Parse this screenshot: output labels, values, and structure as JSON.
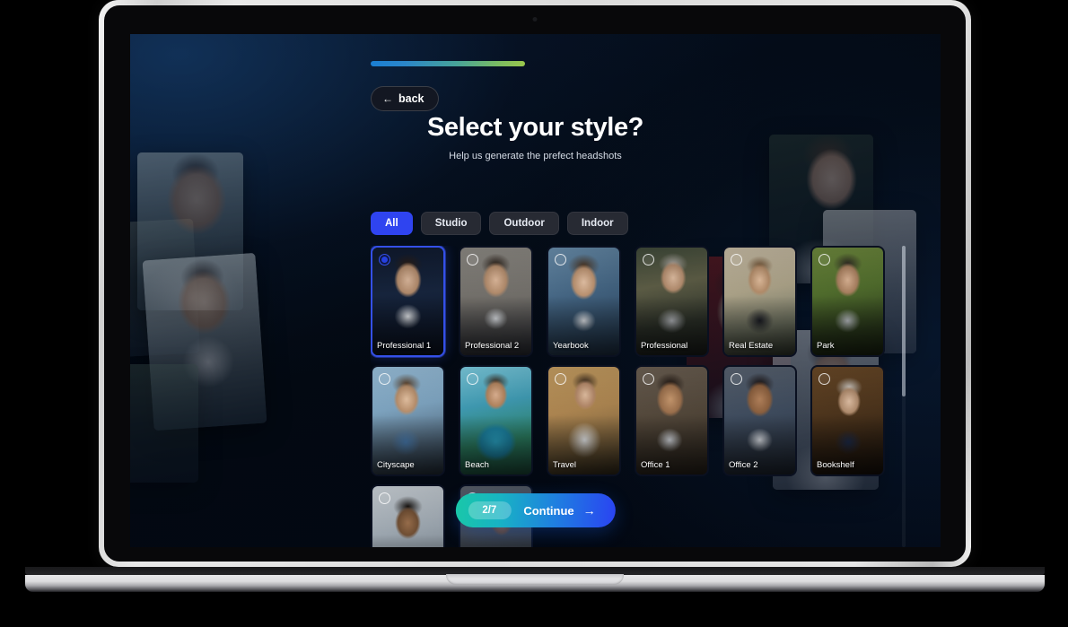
{
  "device": {
    "kind": "laptop-mockup"
  },
  "progress": {
    "value_label": "2/7",
    "percent": 100,
    "gradient_from": "#1a7fd4",
    "gradient_to": "#9ac74b"
  },
  "header": {
    "back_label": "back",
    "back_icon": "arrow-left-icon",
    "title": "Select your style?",
    "subtitle": "Help us generate the prefect headshots"
  },
  "filters": {
    "items": [
      {
        "label": "All",
        "active": true
      },
      {
        "label": "Studio",
        "active": false
      },
      {
        "label": "Outdoor",
        "active": false
      },
      {
        "label": "Indoor",
        "active": false
      }
    ],
    "active_color": "#2f44f0"
  },
  "styles": {
    "cards": [
      {
        "label": "Professional 1",
        "selected": true,
        "scene": "studio-dark-navy-suit"
      },
      {
        "label": "Professional 2",
        "selected": false,
        "scene": "studio-gray-backdrop-suit"
      },
      {
        "label": "Yearbook",
        "selected": false,
        "scene": "blue-mottled-backdrop"
      },
      {
        "label": "Professional",
        "selected": false,
        "scene": "city-street-gray-suit"
      },
      {
        "label": "Real Estate",
        "selected": false,
        "scene": "house-exterior"
      },
      {
        "label": "Park",
        "selected": false,
        "scene": "green-park-trees"
      },
      {
        "label": "Cityscape",
        "selected": false,
        "scene": "city-skyline-daylight"
      },
      {
        "label": "Beach",
        "selected": false,
        "scene": "tropical-beach-palms"
      },
      {
        "label": "Travel",
        "selected": false,
        "scene": "pyramid-desert"
      },
      {
        "label": "Office 1",
        "selected": false,
        "scene": "office-interior-warm"
      },
      {
        "label": "Office 2",
        "selected": false,
        "scene": "office-interior-blue"
      },
      {
        "label": "Bookshelf",
        "selected": false,
        "scene": "library-bookshelf"
      },
      {
        "label": "",
        "selected": false,
        "scene": "outdoor-portrait-smile"
      },
      {
        "label": "",
        "selected": false,
        "scene": "glass-building-night"
      }
    ]
  },
  "footer": {
    "step_label": "2/7",
    "continue_label": "Continue",
    "continue_icon": "arrow-right-icon",
    "gradient_from": "#19c8a8",
    "gradient_to": "#2a43f2"
  },
  "collage": {
    "left": [
      {
        "scene": "young-man-white-shirt"
      },
      {
        "scene": "young-man-gray-suit-tie"
      },
      {
        "scene": "partial-person-left"
      }
    ],
    "right": [
      {
        "scene": "woman-white-shirt-dark-bg"
      },
      {
        "scene": "woman-red-backdrop"
      },
      {
        "scene": "woman-light-blazer"
      },
      {
        "scene": "woman-partial-right"
      }
    ]
  }
}
